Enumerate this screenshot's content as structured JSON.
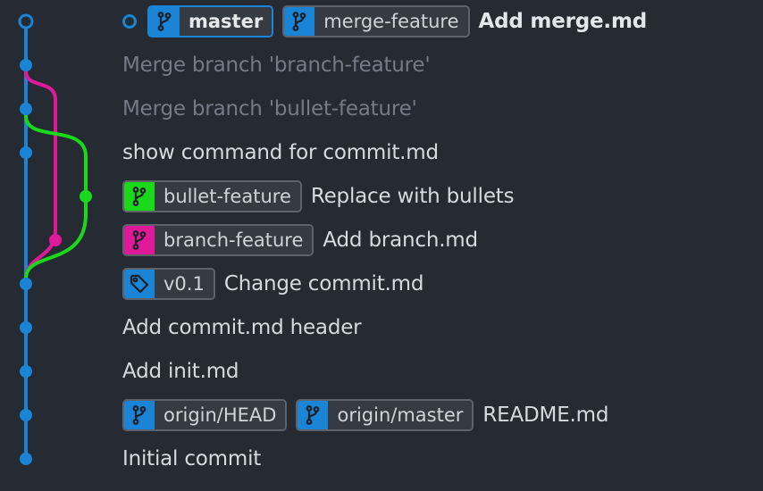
{
  "colors": {
    "background": "#262a33",
    "main_lane": "#1a84d6",
    "branch_feature_lane": "#e0199b",
    "bullet_feature_lane": "#1ad81a",
    "ref_label_bg": "#363a43",
    "dim_text": "#757b86"
  },
  "commits": [
    {
      "message": "Add merge.md",
      "style": "bold",
      "is_head": true,
      "refs": [
        {
          "type": "branch",
          "name": "master",
          "current": true,
          "color": "#1a84d6",
          "icon": "git-branch-icon"
        },
        {
          "type": "branch",
          "name": "merge-feature",
          "current": false,
          "color": "#1a84d6",
          "icon": "git-branch-icon"
        }
      ]
    },
    {
      "message": "Merge branch 'branch-feature'",
      "style": "dim",
      "refs": []
    },
    {
      "message": "Merge branch 'bullet-feature'",
      "style": "dim",
      "refs": []
    },
    {
      "message": "show command for commit.md",
      "style": "normal",
      "refs": []
    },
    {
      "message": "Replace with bullets",
      "style": "normal",
      "refs": [
        {
          "type": "branch",
          "name": "bullet-feature",
          "current": false,
          "color": "#1ad81a",
          "icon": "git-branch-icon"
        }
      ]
    },
    {
      "message": "Add branch.md",
      "style": "normal",
      "refs": [
        {
          "type": "branch",
          "name": "branch-feature",
          "current": false,
          "color": "#e0199b",
          "icon": "git-branch-icon"
        }
      ]
    },
    {
      "message": "Change commit.md",
      "style": "normal",
      "refs": [
        {
          "type": "tag",
          "name": "v0.1",
          "current": false,
          "color": "#1a84d6",
          "icon": "tag-icon"
        }
      ]
    },
    {
      "message": "Add commit.md header",
      "style": "normal",
      "refs": []
    },
    {
      "message": "Add init.md",
      "style": "normal",
      "refs": []
    },
    {
      "message": "README.md",
      "style": "normal",
      "refs": [
        {
          "type": "branch",
          "name": "origin/HEAD",
          "current": false,
          "color": "#1a84d6",
          "icon": "git-branch-icon"
        },
        {
          "type": "branch",
          "name": "origin/master",
          "current": false,
          "color": "#1a84d6",
          "icon": "git-branch-icon"
        }
      ]
    },
    {
      "message": "Initial commit",
      "style": "normal",
      "refs": []
    }
  ]
}
